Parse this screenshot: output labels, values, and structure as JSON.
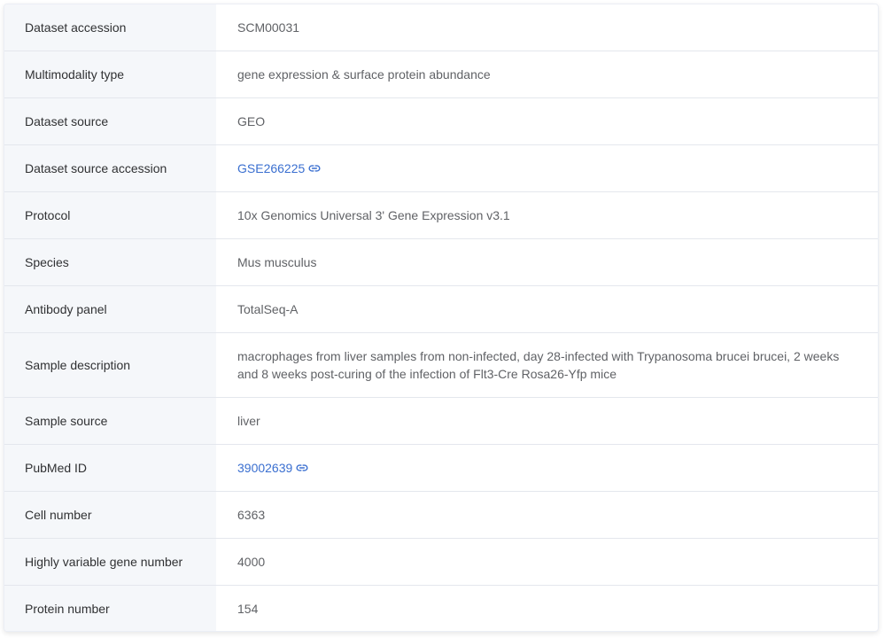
{
  "rows": [
    {
      "label": "Dataset accession",
      "value": "SCM00031"
    },
    {
      "label": "Multimodality type",
      "value": "gene expression & surface protein abundance"
    },
    {
      "label": "Dataset source",
      "value": "GEO"
    },
    {
      "label": "Dataset source accession",
      "value": "GSE266225",
      "link": true
    },
    {
      "label": "Protocol",
      "value": "10x Genomics Universal 3' Gene Expression v3.1"
    },
    {
      "label": "Species",
      "value": "Mus musculus"
    },
    {
      "label": "Antibody panel",
      "value": "TotalSeq-A"
    },
    {
      "label": "Sample description",
      "value": "macrophages from liver samples from non-infected, day 28-infected with Trypanosoma brucei brucei, 2 weeks and 8 weeks post-curing of the infection of Flt3-Cre Rosa26-Yfp mice"
    },
    {
      "label": "Sample source",
      "value": "liver"
    },
    {
      "label": "PubMed ID",
      "value": "39002639",
      "link": true
    },
    {
      "label": "Cell number",
      "value": "6363"
    },
    {
      "label": "Highly variable gene number",
      "value": "4000"
    },
    {
      "label": "Protein number",
      "value": "154"
    }
  ],
  "icons": {
    "external_link": "link-icon"
  },
  "colors": {
    "label_background": "#f5f7fa",
    "link": "#3a6fd0",
    "border": "#e4e7ed"
  }
}
